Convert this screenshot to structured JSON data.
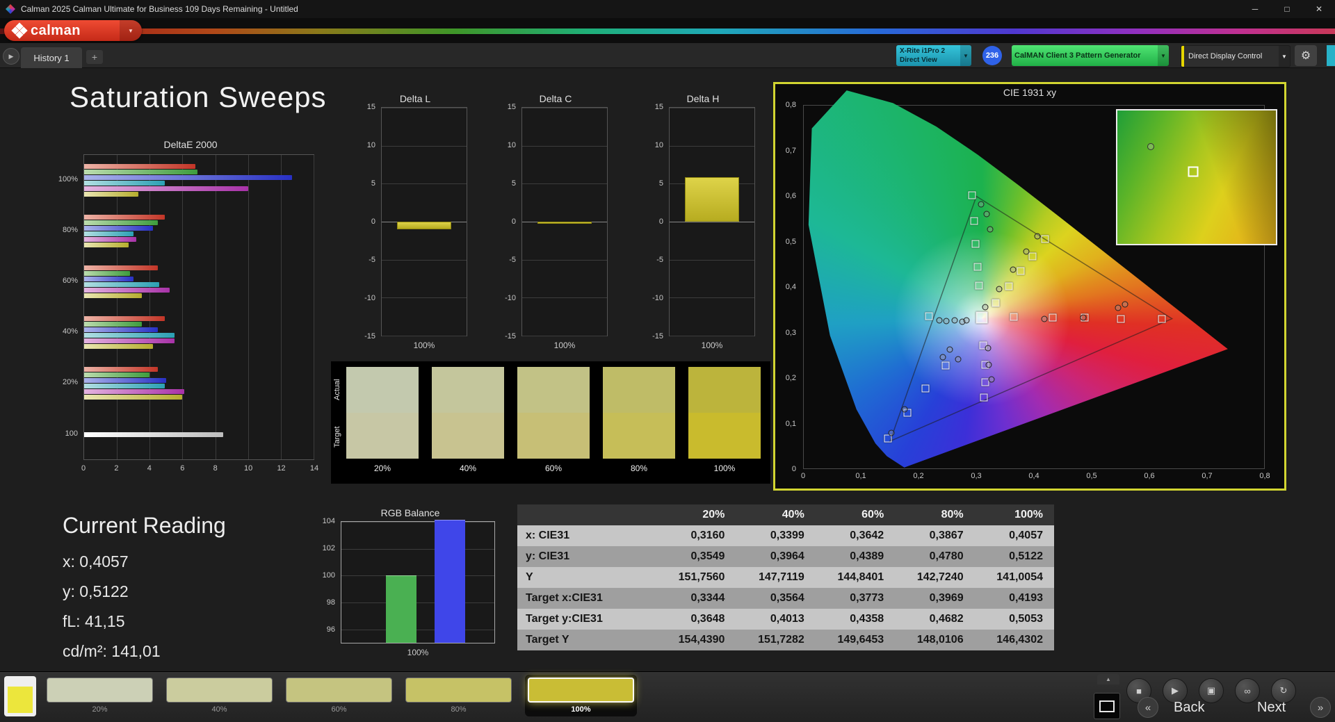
{
  "colors": {
    "accent_yellow": "#d2d531",
    "badge_blue": "#2f62e8",
    "stripe_yellow": "#e6d600",
    "logo_red": "#d93a25",
    "meter_teal": "#2ab4cb",
    "pattern_green": "#3bd968",
    "bar_yellow": "#cfc52d"
  },
  "window": {
    "title": "Calman 2025 Calman Ultimate for Business 109 Days Remaining - Untitled"
  },
  "icons": {
    "minimize": "─",
    "maximize": "□",
    "close": "✕",
    "caret_down": "▼",
    "gear": "⚙",
    "add_tab": "+",
    "tab_play": "▶",
    "collapse_up": "▲",
    "prev": "«",
    "next": "»",
    "transport": [
      {
        "name": "stop",
        "glyph": "■"
      },
      {
        "name": "play",
        "glyph": "▶"
      },
      {
        "name": "save",
        "glyph": "▣"
      },
      {
        "name": "link",
        "glyph": "∞"
      },
      {
        "name": "refresh",
        "glyph": "↻"
      }
    ]
  },
  "header": {
    "logo_text": "calman"
  },
  "tab_bar": {
    "history_tab": "History 1"
  },
  "toolbar": {
    "meter_line1": "X-Rite i1Pro 2",
    "meter_line2": "Direct View",
    "badge_count": "236",
    "pattern_generator": "CalMAN Client 3 Pattern Generator",
    "display_control": "Direct Display Control"
  },
  "page": {
    "title": "Saturation Sweeps"
  },
  "current_reading": {
    "title": "Current Reading",
    "x": "x: 0,4057",
    "y": "y: 0,5122",
    "fl": "fL: 41,15",
    "cdm2": "cd/m²: 141,01"
  },
  "patches": {
    "row_labels": [
      "Actual",
      "Target"
    ],
    "columns": [
      "20%",
      "40%",
      "60%",
      "80%",
      "100%"
    ],
    "actual_colors": [
      "#c3c9ae",
      "#c4c69c",
      "#c2c286",
      "#bfbc67",
      "#bcb43c"
    ],
    "target_colors": [
      "#c7c7a5",
      "#c8c390",
      "#c7bf76",
      "#c6be58",
      "#c9bb2d"
    ]
  },
  "results_table": {
    "columns": [
      "20%",
      "40%",
      "60%",
      "80%",
      "100%"
    ],
    "rows": [
      {
        "label": "x: CIE31",
        "values": [
          "0,3160",
          "0,3399",
          "0,3642",
          "0,3867",
          "0,4057"
        ]
      },
      {
        "label": "y: CIE31",
        "values": [
          "0,3549",
          "0,3964",
          "0,4389",
          "0,4780",
          "0,5122"
        ]
      },
      {
        "label": "Y",
        "values": [
          "151,7560",
          "147,7119",
          "144,8401",
          "142,7240",
          "141,0054"
        ]
      },
      {
        "label": "Target x:CIE31",
        "values": [
          "0,3344",
          "0,3564",
          "0,3773",
          "0,3969",
          "0,4193"
        ]
      },
      {
        "label": "Target y:CIE31",
        "values": [
          "0,3648",
          "0,4013",
          "0,4358",
          "0,4682",
          "0,5053"
        ]
      },
      {
        "label": "Target Y",
        "values": [
          "154,4390",
          "151,7282",
          "149,6453",
          "148,0106",
          "146,4302"
        ]
      }
    ]
  },
  "bottom_bar": {
    "selected_swatch_color": "#ece63c",
    "patches": [
      {
        "label": "20%",
        "color": "#ccd0b6",
        "selected": false
      },
      {
        "label": "40%",
        "color": "#cbcc9e",
        "selected": false
      },
      {
        "label": "60%",
        "color": "#c5c480",
        "selected": false
      },
      {
        "label": "80%",
        "color": "#c6c266",
        "selected": false
      },
      {
        "label": "100%",
        "color": "#c9bd35",
        "selected": true
      }
    ],
    "back_label": "Back",
    "next_label": "Next"
  },
  "chart_data": [
    {
      "id": "deltae_2000",
      "type": "bar",
      "orientation": "horizontal",
      "title": "DeltaE 2000",
      "categories": [
        "100%",
        "80%",
        "60%",
        "40%",
        "20%",
        "100"
      ],
      "xlim": [
        0,
        14
      ],
      "xticks": [
        "0",
        "2",
        "4",
        "6",
        "8",
        "10",
        "12",
        "14"
      ],
      "series": [
        {
          "name": "Red",
          "gradient": [
            "#edb3a6",
            "#c23527"
          ],
          "values": [
            6.8,
            4.9,
            4.5,
            4.9,
            4.5,
            null
          ]
        },
        {
          "name": "Green",
          "gradient": [
            "#bcdcae",
            "#3e9c3e"
          ],
          "values": [
            6.9,
            4.5,
            2.8,
            3.5,
            4.0,
            null
          ]
        },
        {
          "name": "Blue",
          "gradient": [
            "#aab3ea",
            "#2830c4"
          ],
          "values": [
            12.7,
            4.2,
            3.0,
            4.5,
            5.0,
            null
          ]
        },
        {
          "name": "Cyan",
          "gradient": [
            "#b2dfe2",
            "#2ba0b4"
          ],
          "values": [
            4.9,
            3.0,
            4.6,
            5.5,
            4.9,
            null
          ]
        },
        {
          "name": "Magenta",
          "gradient": [
            "#e4b4e0",
            "#a832a8"
          ],
          "values": [
            10.0,
            3.2,
            5.2,
            5.5,
            6.1,
            null
          ]
        },
        {
          "name": "Yellow",
          "gradient": [
            "#eae6b2",
            "#b5ad2e"
          ],
          "values": [
            3.3,
            2.7,
            3.5,
            4.2,
            6.0,
            null
          ]
        },
        {
          "name": "White",
          "gradient": [
            "#ffffff",
            "#bdbdbd"
          ],
          "values": [
            null,
            null,
            null,
            null,
            null,
            8.5
          ]
        }
      ]
    },
    {
      "id": "delta_l",
      "type": "bar",
      "title": "Delta L",
      "categories": [
        "100%"
      ],
      "values": [
        -1.0
      ],
      "ylim": [
        -15,
        15
      ],
      "yticks": [
        "15",
        "10",
        "5",
        "0",
        "-5",
        "-10",
        "-15"
      ]
    },
    {
      "id": "delta_c",
      "type": "bar",
      "title": "Delta C",
      "categories": [
        "100%"
      ],
      "values": [
        -0.3
      ],
      "ylim": [
        -15,
        15
      ],
      "yticks": [
        "15",
        "10",
        "5",
        "0",
        "-5",
        "-10",
        "-15"
      ]
    },
    {
      "id": "delta_h",
      "type": "bar",
      "title": "Delta H",
      "categories": [
        "100%"
      ],
      "values": [
        5.8
      ],
      "ylim": [
        -15,
        15
      ],
      "yticks": [
        "15",
        "10",
        "5",
        "0",
        "-5",
        "-10",
        "-15"
      ]
    },
    {
      "id": "rgb_balance",
      "type": "bar",
      "title": "RGB Balance",
      "categories": [
        "100%"
      ],
      "ylim": [
        95,
        104
      ],
      "yticks": [
        "104",
        "102",
        "100",
        "98",
        "96"
      ],
      "series": [
        {
          "name": "Red",
          "color": "#c23527",
          "value": null
        },
        {
          "name": "Green",
          "color": "#46a84e",
          "value": 99.9
        },
        {
          "name": "Blue",
          "color": "#3c43de",
          "value": 104.0
        }
      ]
    },
    {
      "id": "cie_1931",
      "type": "scatter",
      "title": "CIE 1931 xy",
      "xlim": [
        0,
        0.8
      ],
      "ylim": [
        0,
        0.8
      ],
      "xticks": [
        "0",
        "0,1",
        "0,2",
        "0,3",
        "0,4",
        "0,5",
        "0,6",
        "0,7",
        "0,8"
      ],
      "yticks": [
        "0,8",
        "0,7",
        "0,6",
        "0,5",
        "0,4",
        "0,3",
        "0,2",
        "0,1",
        "0"
      ],
      "white_point": [
        0.309,
        0.333
      ],
      "target_squares": [
        [
          0.293,
          0.603
        ],
        [
          0.296,
          0.546
        ],
        [
          0.299,
          0.495
        ],
        [
          0.302,
          0.444
        ],
        [
          0.305,
          0.403
        ],
        [
          0.334,
          0.365
        ],
        [
          0.356,
          0.401
        ],
        [
          0.377,
          0.436
        ],
        [
          0.397,
          0.468
        ],
        [
          0.419,
          0.505
        ],
        [
          0.365,
          0.334
        ],
        [
          0.433,
          0.333
        ],
        [
          0.488,
          0.332
        ],
        [
          0.551,
          0.33
        ],
        [
          0.622,
          0.33
        ],
        [
          0.246,
          0.227
        ],
        [
          0.212,
          0.176
        ],
        [
          0.18,
          0.123
        ],
        [
          0.146,
          0.066
        ],
        [
          0.312,
          0.272
        ],
        [
          0.315,
          0.229
        ],
        [
          0.316,
          0.19
        ],
        [
          0.313,
          0.157
        ],
        [
          0.218,
          0.335
        ]
      ],
      "measured_points": [
        [
          0.316,
          0.355
        ],
        [
          0.34,
          0.396
        ],
        [
          0.364,
          0.439
        ],
        [
          0.387,
          0.478
        ],
        [
          0.406,
          0.512
        ],
        [
          0.418,
          0.329
        ],
        [
          0.486,
          0.333
        ],
        [
          0.546,
          0.354
        ],
        [
          0.558,
          0.362
        ],
        [
          0.236,
          0.327
        ],
        [
          0.248,
          0.325
        ],
        [
          0.262,
          0.326
        ],
        [
          0.275,
          0.324
        ],
        [
          0.283,
          0.326
        ],
        [
          0.308,
          0.583
        ],
        [
          0.318,
          0.561
        ],
        [
          0.324,
          0.527
        ],
        [
          0.254,
          0.262
        ],
        [
          0.268,
          0.24
        ],
        [
          0.242,
          0.245
        ],
        [
          0.32,
          0.265
        ],
        [
          0.322,
          0.228
        ],
        [
          0.326,
          0.196
        ],
        [
          0.175,
          0.13
        ],
        [
          0.152,
          0.078
        ]
      ]
    }
  ]
}
